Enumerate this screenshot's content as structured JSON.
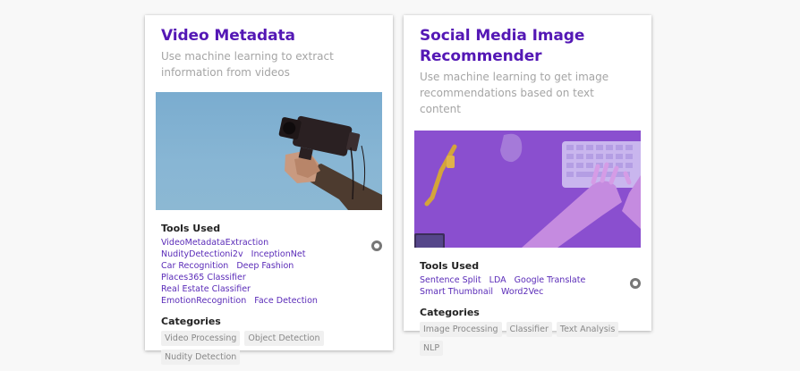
{
  "cards": [
    {
      "title": "Video Metadata",
      "description": "Use machine learning to extract information from videos",
      "tools_heading": "Tools Used",
      "tools": [
        "VideoMetadataExtraction",
        "NudityDetectioni2v",
        "InceptionNet",
        "Car Recognition",
        "Deep Fashion",
        "Places365 Classifier",
        "Real Estate Classifier",
        "EmotionRecognition",
        "Face Detection"
      ],
      "categories_heading": "Categories",
      "categories": [
        "Video Processing",
        "Object Detection",
        "Nudity Detection"
      ],
      "image": "camera-photo",
      "repo_icon": "github-icon"
    },
    {
      "title": "Social Media Image Recommender",
      "description": "Use machine learning to get image recommendations based on text content",
      "tools_heading": "Tools Used",
      "tools": [
        "Sentence Split",
        "LDA",
        "Google Translate",
        "Smart Thumbnail",
        "Word2Vec"
      ],
      "categories_heading": "Categories",
      "categories": [
        "Image Processing",
        "Classifier",
        "Text Analysis",
        "NLP"
      ],
      "image": "keyboard-photo",
      "repo_icon": "github-icon"
    }
  ],
  "colors": {
    "title": "#5418b5",
    "link": "#5a2bb8",
    "chip_bg": "#f0f0f0",
    "purple_image": "#8a4fcf",
    "sky_image": "#7aaccf"
  }
}
